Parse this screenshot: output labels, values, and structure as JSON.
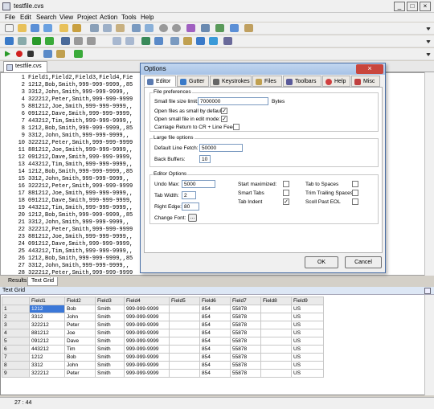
{
  "window": {
    "title": "testfile.cvs"
  },
  "menu": [
    "File",
    "Edit",
    "Search",
    "View",
    "Project",
    "Action",
    "Tools",
    "Help"
  ],
  "document_tab": "testfile.cvs",
  "editor_lines": [
    {
      "n": "1",
      "t": "Field1,Field2,Field3,Field4,Fie"
    },
    {
      "n": "2",
      "t": "1212,Bob,Smith,999-999-9999,,85"
    },
    {
      "n": "3",
      "t": "3312,John,Smith,999-999-9999,,"
    },
    {
      "n": "4",
      "t": "322212,Peter,Smith,999-999-9999"
    },
    {
      "n": "5",
      "t": "881212,Joe,Smith,999-999-9999,,"
    },
    {
      "n": "6",
      "t": "091212,Dave,Smith,999-999-9999,"
    },
    {
      "n": "7",
      "t": "443212,Tim,Smith,999-999-9999,,"
    },
    {
      "n": "8",
      "t": "1212,Bob,Smith,999-999-9999,,85"
    },
    {
      "n": "9",
      "t": "3312,John,Smith,999-999-9999,,"
    },
    {
      "n": "10",
      "t": "322212,Peter,Smith,999-999-9999"
    },
    {
      "n": "11",
      "t": "881212,Joe,Smith,999-999-9999,,"
    },
    {
      "n": "12",
      "t": "091212,Dave,Smith,999-999-9999,"
    },
    {
      "n": "13",
      "t": "443212,Tim,Smith,999-999-9999,,"
    },
    {
      "n": "14",
      "t": "1212,Bob,Smith,999-999-9999,,85"
    },
    {
      "n": "15",
      "t": "3312,John,Smith,999-999-9999,,"
    },
    {
      "n": "16",
      "t": "322212,Peter,Smith,999-999-9999"
    },
    {
      "n": "17",
      "t": "881212,Joe,Smith,999-999-9999,,"
    },
    {
      "n": "18",
      "t": "091212,Dave,Smith,999-999-9999,"
    },
    {
      "n": "19",
      "t": "443212,Tim,Smith,999-999-9999,,"
    },
    {
      "n": "20",
      "t": "1212,Bob,Smith,999-999-9999,,85"
    },
    {
      "n": "21",
      "t": "3312,John,Smith,999-999-9999,,"
    },
    {
      "n": "22",
      "t": "322212,Peter,Smith,999-999-9999"
    },
    {
      "n": "23",
      "t": "881212,Joe,Smith,999-999-9999,,"
    },
    {
      "n": "24",
      "t": "091212,Dave,Smith,999-999-9999,"
    },
    {
      "n": "25",
      "t": "443212,Tim,Smith,999-999-9999,,"
    },
    {
      "n": "26",
      "t": "1212,Bob,Smith,999-999-9999,,85"
    },
    {
      "n": "27",
      "t": "3312,John,Smith,999-999-9999,,"
    },
    {
      "n": "28",
      "t": "322212,Peter,Smith,999-999-9999"
    }
  ],
  "bottom_tabs": [
    "Results",
    "Text Grid"
  ],
  "grid": {
    "title": "Text Grid",
    "headers": [
      "Field1",
      "Field2",
      "Field3",
      "Field4",
      "Field5",
      "Field6",
      "Field7",
      "Field8",
      "Field9"
    ],
    "rows": [
      [
        "1",
        "1212",
        "Bob",
        "Smith",
        "999-999-9999",
        "",
        "854",
        "55878",
        "",
        "US"
      ],
      [
        "2",
        "3312",
        "John",
        "Smith",
        "999-999-9999",
        "",
        "854",
        "55878",
        "",
        "US"
      ],
      [
        "3",
        "322212",
        "Peter",
        "Smith",
        "999-999-9999",
        "",
        "854",
        "55878",
        "",
        "US"
      ],
      [
        "4",
        "881212",
        "Joe",
        "Smith",
        "999-999-9999",
        "",
        "854",
        "55878",
        "",
        "US"
      ],
      [
        "5",
        "091212",
        "Dave",
        "Smith",
        "999-999-9999",
        "",
        "854",
        "55878",
        "",
        "US"
      ],
      [
        "6",
        "443212",
        "Tim",
        "Smith",
        "999-999-9999",
        "",
        "854",
        "55878",
        "",
        "US"
      ],
      [
        "7",
        "1212",
        "Bob",
        "Smith",
        "999-999-9999",
        "",
        "854",
        "55878",
        "",
        "US"
      ],
      [
        "8",
        "3312",
        "John",
        "Smith",
        "999-999-9999",
        "",
        "854",
        "55878",
        "",
        "US"
      ],
      [
        "9",
        "322212",
        "Peter",
        "Smith",
        "999-999-9999",
        "",
        "854",
        "55878",
        "",
        "US"
      ]
    ]
  },
  "status": {
    "position": "27 : 44"
  },
  "dialog": {
    "title": "Options",
    "tabs": [
      "Editor",
      "Gutter",
      "Keystrokes",
      "Files",
      "Toolbars",
      "Help",
      "Misc"
    ],
    "file_prefs": {
      "group": "File preferences",
      "small_limit_label": "Small file size limit:",
      "small_limit_value": "7000000",
      "small_limit_unit": "Bytes",
      "open_small_label": "Open files as small by default:",
      "open_small_checked": true,
      "edit_mode_label": "Open small file in edit mode:",
      "edit_mode_checked": true,
      "carriage_label": "Carriage Return to CR + Line Feed",
      "carriage_checked": false
    },
    "large_file": {
      "group": "Large file options",
      "fetch_label": "Default Line Fetch:",
      "fetch_value": "50000",
      "buffers_label": "Back Buffers:",
      "buffers_value": "10"
    },
    "editor_opts": {
      "group": "Editor Options",
      "undo_label": "Undo Max:",
      "undo_value": "5000",
      "tab_width_label": "Tab Width:",
      "tab_width_value": "2",
      "right_edge_label": "Right Edge:",
      "right_edge_value": "80",
      "change_font_label": "Change Font:",
      "change_font_btn": "...",
      "start_max_label": "Start maximized:",
      "start_max_checked": false,
      "smart_tabs_label": "Smart Tabs",
      "smart_tabs_checked": false,
      "tab_indent_label": "Tab Indent",
      "tab_indent_checked": true,
      "tab_spaces_label": "Tab to Spaces",
      "tab_spaces_checked": false,
      "trim_label": "Trim Trailing Spaces",
      "trim_checked": false,
      "scroll_eol_label": "Scoll Past EOL",
      "scroll_eol_checked": false
    },
    "ok": "OK",
    "cancel": "Cancel"
  }
}
